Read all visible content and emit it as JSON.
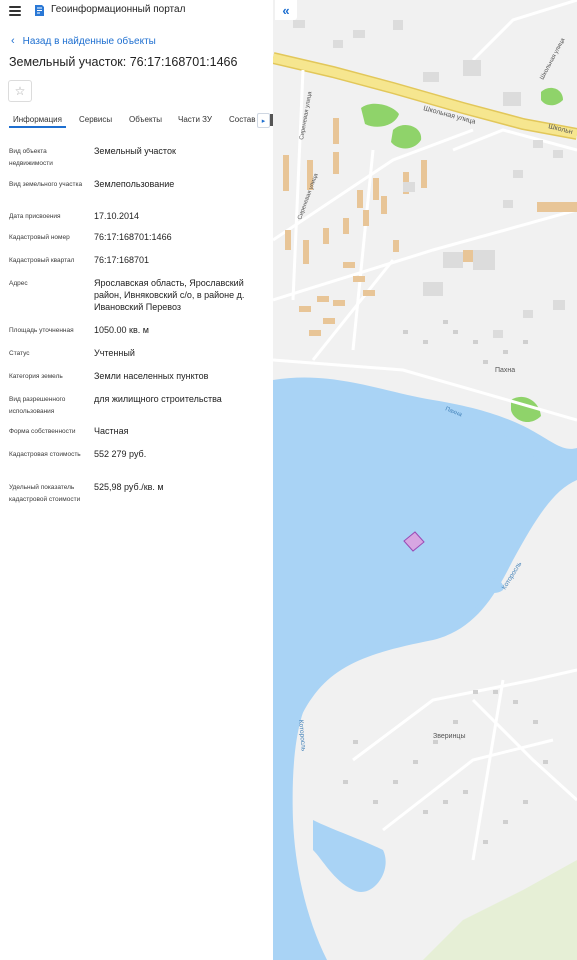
{
  "header": {
    "app_title": "Геоинформационный портал",
    "menu_icon": "hamburger-menu-icon",
    "logo_icon": "portal-logo-icon"
  },
  "nav": {
    "back_label": "Назад в найденные объекты"
  },
  "object": {
    "title": "Земельный участок: 76:17:168701:1466",
    "favorite_icon": "star-icon"
  },
  "tabs": [
    {
      "label": "Информация",
      "active": true
    },
    {
      "label": "Сервисы"
    },
    {
      "label": "Объекты"
    },
    {
      "label": "Части ЗУ"
    },
    {
      "label": "Состав"
    }
  ],
  "properties": [
    {
      "label": "Вид объекта недвижимости",
      "value": "Земельный участок"
    },
    {
      "label": "Вид земельного участка",
      "value": "Землепользование"
    },
    {
      "label": "Дата присвоения",
      "value": "17.10.2014"
    },
    {
      "label": "Кадастровый номер",
      "value": "76:17:168701:1466"
    },
    {
      "label": "Кадастровый квартал",
      "value": "76:17:168701"
    },
    {
      "label": "Адрес",
      "value": "Ярославская область, Ярославский район, Ивняковский с/о, в районе д. Ивановский Перевоз"
    },
    {
      "label": "Площадь уточненная",
      "value": "1050.00 кв. м"
    },
    {
      "label": "Статус",
      "value": "Учтенный"
    },
    {
      "label": "Категория земель",
      "value": "Земли населенных пунктов"
    },
    {
      "label": "Вид разрешенного использования",
      "value": "для жилищного строительства"
    },
    {
      "label": "Форма собственности",
      "value": "Частная"
    },
    {
      "label": "Кадастровая стоимость",
      "value": "552 279 руб."
    },
    {
      "label": "Удельный показатель кадастровой стоимости",
      "value": "525,98 руб./кв. м"
    }
  ],
  "map": {
    "collapse_icon": "double-chevron-left-icon",
    "labels": {
      "street_main": "Школьная улица",
      "street_main_2": "Школьн",
      "street_school": "Школьная улица",
      "street_siren": "Сиреневая улица",
      "street_siren_2": "Сиреневая улица",
      "river_pakhna": "Пахна",
      "village_pakhna": "Пахна",
      "river_kotorosl": "Которосль",
      "river_kotorosl_2": "Которосль",
      "village_zverintsy": "Зверинцы"
    },
    "colors": {
      "water": "#a9d3f5",
      "road": "#f6e68f",
      "building": "#e8c597",
      "parcel": "#d7a6e2",
      "green": "#8fd36a"
    }
  }
}
